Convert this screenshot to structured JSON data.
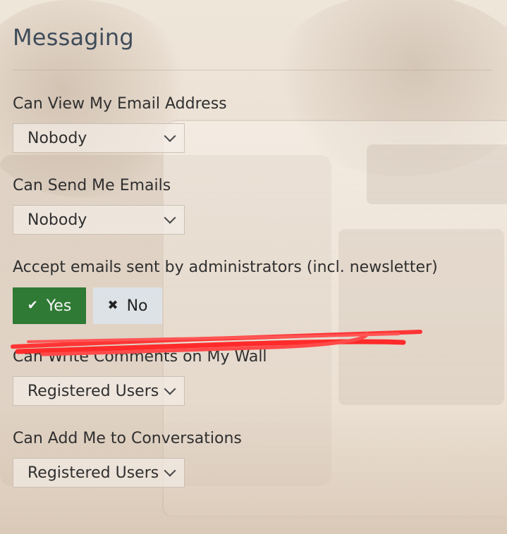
{
  "section": {
    "title": "Messaging"
  },
  "fields": {
    "view_email": {
      "label": "Can View My Email Address",
      "value": "Nobody"
    },
    "send_emails": {
      "label": "Can Send Me Emails",
      "value": "Nobody"
    },
    "admin_emails": {
      "label": "Accept emails sent by administrators (incl. newsletter)",
      "yes_label": "Yes",
      "no_label": "No"
    },
    "wall_comments": {
      "label": "Can Write Comments on My Wall",
      "value": "Registered Users"
    },
    "conversations": {
      "label": "Can Add Me to Conversations",
      "value": "Registered Users"
    }
  },
  "icons": {
    "check": "check-icon",
    "close": "x-icon",
    "dropdown": "chevron-down-icon"
  },
  "colors": {
    "yes_button": "#2f7a34",
    "no_button": "#dce4ea",
    "scribble": "#ff2a2a"
  }
}
